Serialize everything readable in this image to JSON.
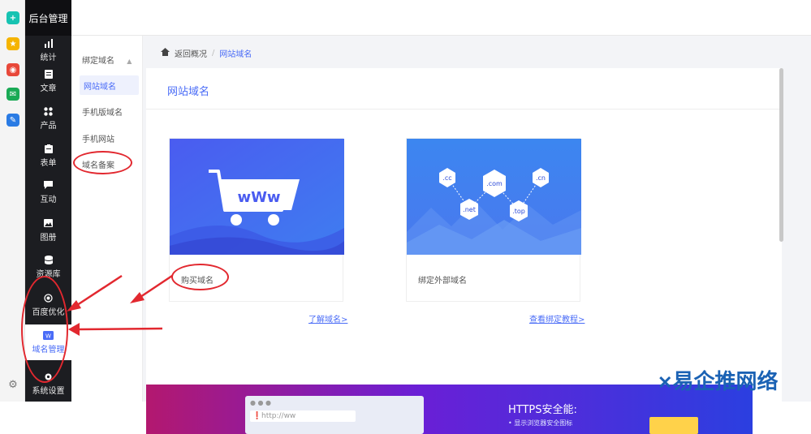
{
  "brand": {
    "title": "后台管理"
  },
  "browser_icons": [
    "plus-icon",
    "star-icon",
    "weibo-icon",
    "mail-icon",
    "edit-icon"
  ],
  "sidebar": {
    "items": [
      {
        "label": "统计",
        "icon": "chart-icon"
      },
      {
        "label": "文章",
        "icon": "article-icon"
      },
      {
        "label": "产品",
        "icon": "grid-icon"
      },
      {
        "label": "表单",
        "icon": "form-icon"
      },
      {
        "label": "互动",
        "icon": "chat-icon"
      },
      {
        "label": "图册",
        "icon": "album-icon"
      },
      {
        "label": "资源库",
        "icon": "database-icon"
      },
      {
        "label": "百度优化",
        "icon": "target-icon"
      },
      {
        "label": "域名管理",
        "icon": "domain-icon"
      },
      {
        "label": "系统设置",
        "icon": "settings-icon"
      }
    ],
    "active": "域名管理"
  },
  "submenu": {
    "header": "绑定域名",
    "items": [
      "网站域名",
      "手机版域名",
      "手机网站",
      "域名备案"
    ],
    "active": "网站域名"
  },
  "breadcrumb": {
    "back": "返回概况",
    "separator": "/",
    "current": "网站域名"
  },
  "panel": {
    "title": "网站域名",
    "cards": [
      {
        "caption": "购买域名",
        "banner_text": "wWw",
        "link": "了解域名>"
      },
      {
        "caption": "绑定外部域名",
        "tags": [
          ".cc",
          ".com",
          ".cn",
          ".net",
          ".top"
        ],
        "link": "查看绑定教程>"
      }
    ]
  },
  "promo": {
    "heading": "HTTPS安全能:",
    "address_bar": "http://ww",
    "bullet": "• 显示浏览器安全图标"
  },
  "watermark": "易企推网络",
  "colors": {
    "accent": "#4a6cf7",
    "sidebar": "#1c1d21",
    "annotation": "#e2282f"
  }
}
